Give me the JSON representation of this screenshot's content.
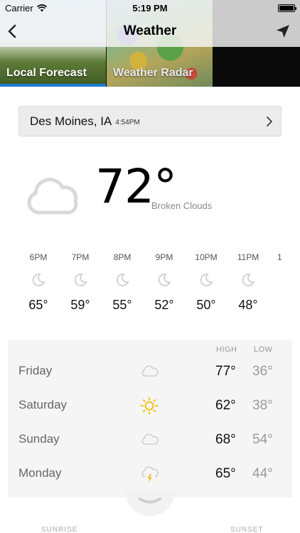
{
  "status_bar": {
    "carrier": "Carrier",
    "time": "5:19 PM"
  },
  "nav": {
    "title": "Weather"
  },
  "tabs": [
    {
      "label": "Local Forecast",
      "selected": true
    },
    {
      "label": "Weather Radar",
      "selected": false
    }
  ],
  "location": {
    "city": "Des Moines, IA",
    "time": "4:54PM"
  },
  "current": {
    "temperature": "72°",
    "condition": "Broken Clouds",
    "icon": "cloud-icon"
  },
  "hourly": [
    {
      "time": "6PM",
      "temp": "65°",
      "icon": "moon-icon"
    },
    {
      "time": "7PM",
      "temp": "59°",
      "icon": "moon-icon"
    },
    {
      "time": "8PM",
      "temp": "55°",
      "icon": "moon-icon"
    },
    {
      "time": "9PM",
      "temp": "52°",
      "icon": "moon-icon"
    },
    {
      "time": "10PM",
      "temp": "50°",
      "icon": "moon-icon"
    },
    {
      "time": "11PM",
      "temp": "48°",
      "icon": "moon-icon"
    },
    {
      "time": "1",
      "temp": "",
      "icon": ""
    }
  ],
  "daily": {
    "high_label": "HIGH",
    "low_label": "LOW",
    "days": [
      {
        "day": "Friday",
        "high": "77°",
        "low": "36°",
        "icon": "cloud-icon"
      },
      {
        "day": "Saturday",
        "high": "62°",
        "low": "38°",
        "icon": "sun-icon"
      },
      {
        "day": "Sunday",
        "high": "68°",
        "low": "54°",
        "icon": "cloud-icon"
      },
      {
        "day": "Monday",
        "high": "65°",
        "low": "44°",
        "icon": "thunderstorm-icon"
      }
    ]
  },
  "sun": {
    "sunrise_label": "SUNRISE",
    "sunset_label": "SUNSET"
  },
  "colors": {
    "accent": "#1e7bd6",
    "sun": "#f2c21a",
    "icon_gray": "#cfcfcf"
  }
}
